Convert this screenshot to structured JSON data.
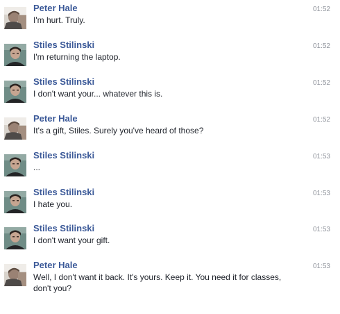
{
  "messages": [
    {
      "sender": "Peter Hale",
      "avatar": "peter-avatar",
      "text": "I'm hurt. Truly.",
      "time": "01:52"
    },
    {
      "sender": "Stiles Stilinski",
      "avatar": "stiles-avatar",
      "text": "I'm returning the laptop.",
      "time": "01:52"
    },
    {
      "sender": "Stiles Stilinski",
      "avatar": "stiles-avatar",
      "text": "I don't want your... whatever this is.",
      "time": "01:52"
    },
    {
      "sender": "Peter Hale",
      "avatar": "peter-avatar",
      "text": "It's a gift, Stiles. Surely you've heard of those?",
      "time": "01:52"
    },
    {
      "sender": "Stiles Stilinski",
      "avatar": "stiles-avatar",
      "text": "...",
      "time": "01:53"
    },
    {
      "sender": "Stiles Stilinski",
      "avatar": "stiles-avatar",
      "text": "I hate you.",
      "time": "01:53"
    },
    {
      "sender": "Stiles Stilinski",
      "avatar": "stiles-avatar",
      "text": "I don't want your gift.",
      "time": "01:53"
    },
    {
      "sender": "Peter Hale",
      "avatar": "peter-avatar",
      "text": "Well, I don't want it back. It's yours. Keep it. You need it for classes, don't you?",
      "time": "01:53"
    }
  ]
}
